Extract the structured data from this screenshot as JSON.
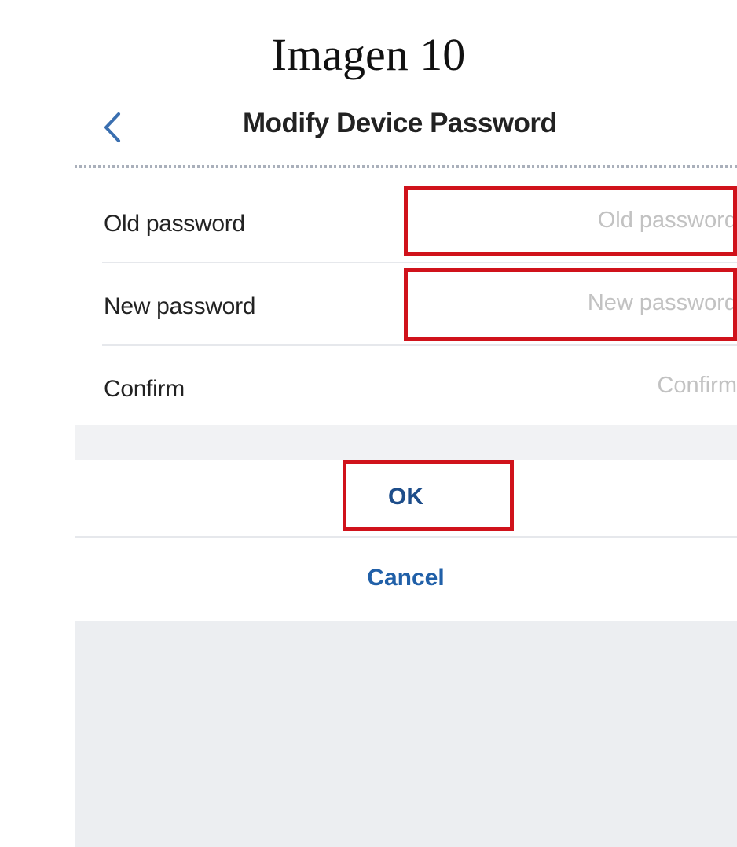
{
  "caption": "Imagen 10",
  "header": {
    "title": "Modify Device Password"
  },
  "form": {
    "fields": [
      {
        "label": "Old password",
        "placeholder": "Old password",
        "value": ""
      },
      {
        "label": "New password",
        "placeholder": "New password",
        "value": ""
      },
      {
        "label": "Confirm",
        "placeholder": "Confirm",
        "value": ""
      }
    ]
  },
  "actions": {
    "ok_label": "OK",
    "cancel_label": "Cancel"
  },
  "colors": {
    "highlight": "#d0121b",
    "link": "#2160a8",
    "background_band": "#f1f2f4"
  },
  "icons": {
    "back": "chevron-left-icon"
  }
}
